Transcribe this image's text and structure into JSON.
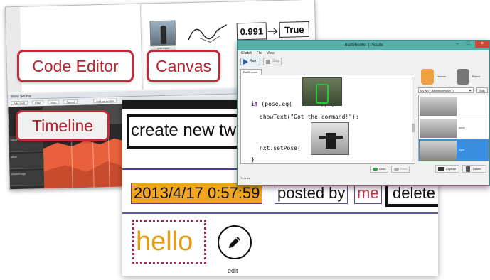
{
  "labels": {
    "code_editor": "Code Editor",
    "canvas": "Canvas",
    "timeline": "Timeline"
  },
  "ide": {
    "canvas_number": "0.991",
    "canvas_bool": "True",
    "canvas_photo_caption": "Color Frame",
    "timeline_title": "Story Source",
    "timeline_tools": [
      "Add cam",
      "Play",
      "Stop",
      "Speed",
      "Add as scripts"
    ],
    "timeline_tracks": [
      "handPosition",
      "label",
      "showImage"
    ],
    "colors": {
      "timeline_fill": "#e8603c",
      "timeline_bg": "#2b2b2b"
    }
  },
  "web": {
    "input_text": "create new tw",
    "post_date": "2013/4/17 0:57:59",
    "posted_by": "posted by",
    "user": "me",
    "delete_label": "delete",
    "post_text": "hello",
    "edit_label": "edit",
    "colors": {
      "date_bg": "#f2a51f",
      "hello_text": "#e39b10",
      "user_text": "#c0364a"
    }
  },
  "picode": {
    "title": "BallShooter | Picode",
    "win_minimize": "–",
    "win_maximize": "□",
    "win_close": "×",
    "menu": [
      "Sketch",
      "File",
      "View"
    ],
    "run_label": "Run",
    "stop_label": "Stop",
    "tab_label": "BallShooter",
    "code": {
      "line1_kw": "if",
      "line1_pre": " (pose.eq(",
      "line1_post": ")) {",
      "line2": "showText(\"Got the command!\");",
      "line3_pre": "nxt.setPose(",
      "line3_post": ");",
      "line4": "}"
    },
    "undo_label": "Undo",
    "redo_label": "Redo",
    "status": "74 lines",
    "human_label": "Human",
    "robot_label": "Robot",
    "nxt_select": "My NXT (MindstormsNXT)",
    "edit_label": "Edit",
    "poses": [
      {
        "name": ""
      },
      {
        "name": "none"
      },
      {
        "name": "right"
      }
    ],
    "selected_pose_index": 2,
    "capture_label": "Capture",
    "delete_label": "Delete",
    "colors": {
      "title_bar": "#54b0a8",
      "selected": "#3a8fe0",
      "keyword": "#7a2a8a"
    }
  }
}
